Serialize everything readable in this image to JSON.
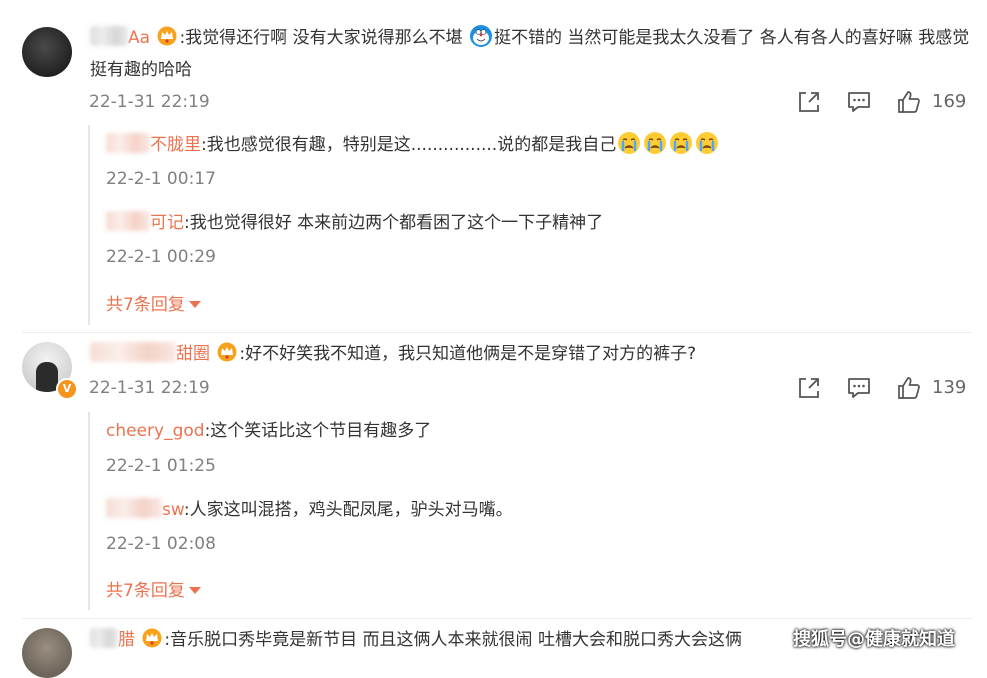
{
  "comments": [
    {
      "username_visible": "Aa",
      "text": ":我觉得还行啊 没有大家说得那么不堪",
      "text2": "挺不错的 当然可能是我太久没看了 各人有各人的喜好嘛 我感觉挺有趣的哈哈",
      "time": "22-1-31 22:19",
      "likes": "169",
      "replies": [
        {
          "username_visible": "不胧里",
          "text": ":我也感觉很有趣，特别是这................说的都是我自己",
          "time": "22-2-1 00:17"
        },
        {
          "username_visible": "可记",
          "text": ":我也觉得很好  本来前边两个都看困了这个一下子精神了",
          "time": "22-2-1 00:29"
        }
      ],
      "more_label": "共7条回复"
    },
    {
      "username_visible": "甜圈",
      "text": ":好不好笑我不知道，我只知道他俩是不是穿错了对方的裤子?",
      "time": "22-1-31 22:19",
      "likes": "139",
      "replies": [
        {
          "username_visible": "cheery_god",
          "text": ":这个笑话比这个节目有趣多了",
          "time": "22-2-1 01:25"
        },
        {
          "username_visible": "sw",
          "text": ":人家这叫混搭，鸡头配凤尾，驴头对马嘴。",
          "time": "22-2-1 02:08"
        }
      ],
      "more_label": "共7条回复"
    },
    {
      "username_visible": "腊",
      "text": ":音乐脱口秀毕竟是新节目 而且这俩人本来就很闹 吐槽大会和脱口秀大会这俩"
    }
  ],
  "watermark": "搜狐号@健康就知道",
  "icons": {
    "share": "share-icon",
    "comment": "comment-icon",
    "like": "thumbs-up-icon",
    "crown": "crown-icon",
    "crying": "crying-face-emoji",
    "doraemon": "doraemon-emoji",
    "verified": "verified-v-badge"
  },
  "colors": {
    "username": "#eb7350",
    "text": "#333333",
    "time": "#808080",
    "divider": "#eeeeee"
  }
}
